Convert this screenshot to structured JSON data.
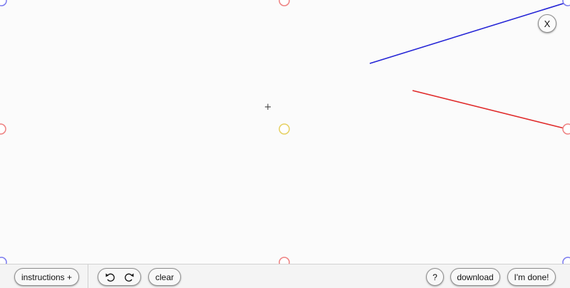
{
  "canvas": {
    "crosshair": "+",
    "lines": [
      {
        "name": "blue-line",
        "color": "#2424d6"
      },
      {
        "name": "red-line",
        "color": "#e02a2a"
      }
    ],
    "handle_colors": {
      "blue": "#7a7aee",
      "red": "#ee8080",
      "yellow": "#e6d060"
    }
  },
  "close_button": {
    "label": "X"
  },
  "toolbar": {
    "instructions_label": "instructions +",
    "undo_icon": "undo-icon",
    "redo_icon": "redo-icon",
    "clear_label": "clear",
    "help_label": "?",
    "download_label": "download",
    "done_label": "I'm done!"
  }
}
